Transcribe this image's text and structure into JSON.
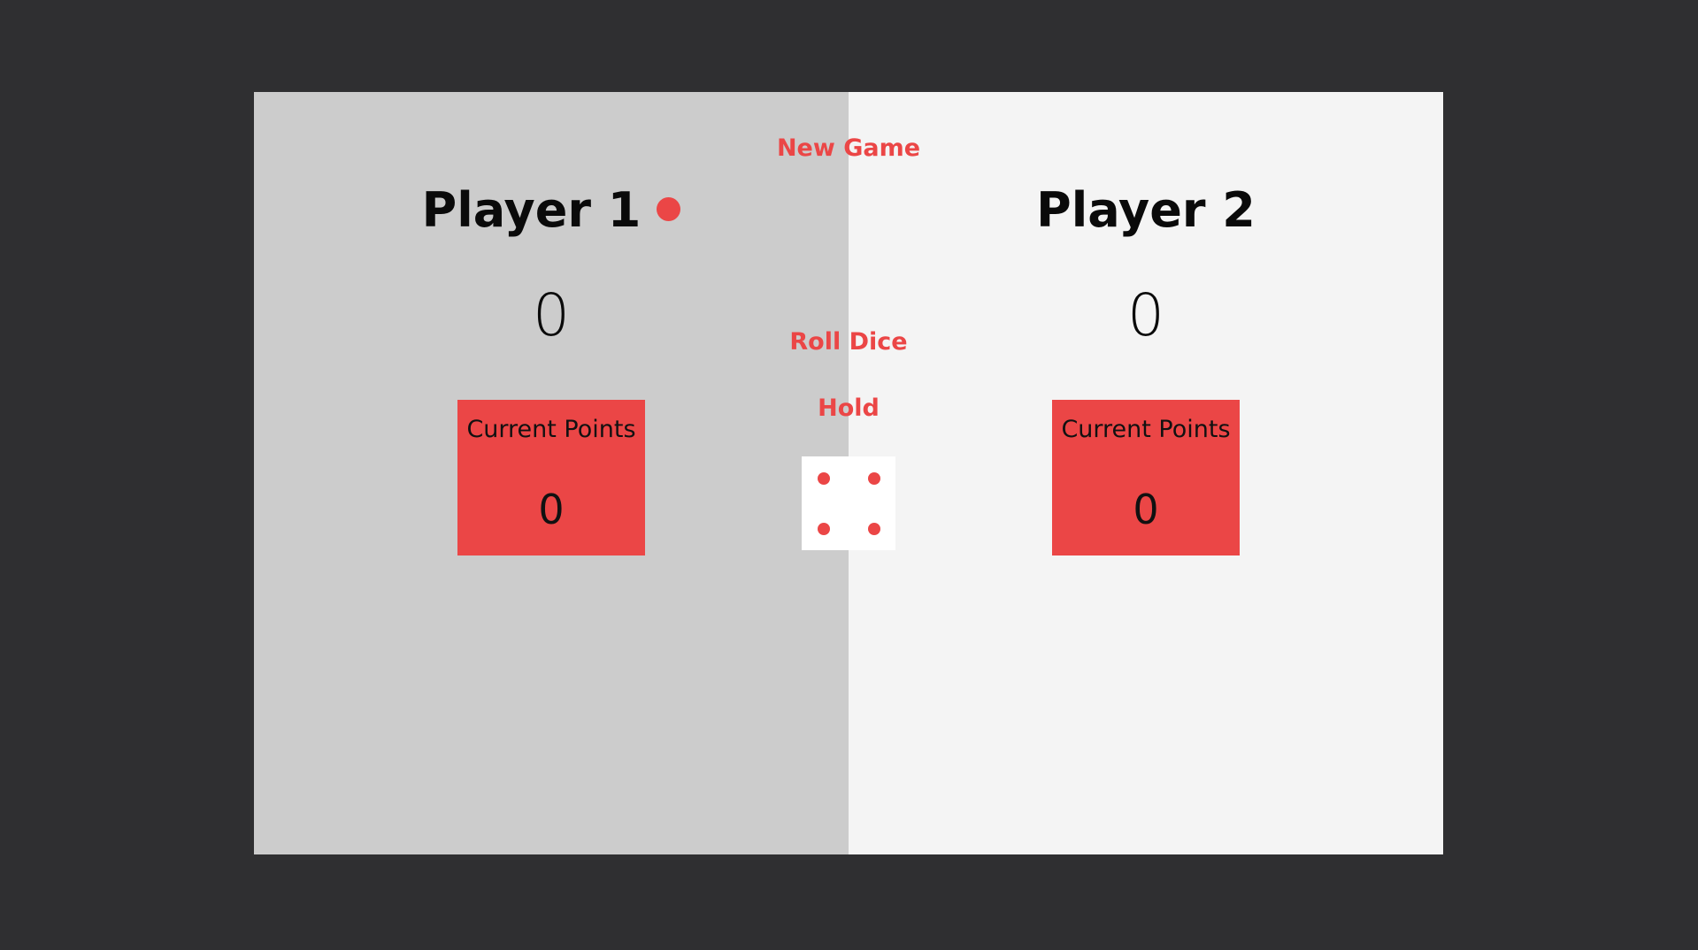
{
  "colors": {
    "background": "#2f2f31",
    "active_panel": "#cccccc",
    "inactive_panel": "#f4f4f4",
    "accent": "#eb4646",
    "dice_face": "#ffffff"
  },
  "controls": {
    "new_game_label": "New Game",
    "roll_dice_label": "Roll Dice",
    "hold_label": "Hold"
  },
  "dice": {
    "value": 4
  },
  "players": [
    {
      "name": "Player 1",
      "score": "0",
      "current_label": "Current Points",
      "current_value": "0",
      "active": true
    },
    {
      "name": "Player 2",
      "score": "0",
      "current_label": "Current Points",
      "current_value": "0",
      "active": false
    }
  ]
}
